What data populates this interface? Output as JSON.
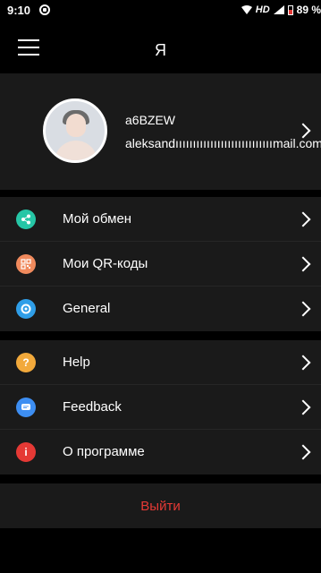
{
  "status_bar": {
    "time": "9:10",
    "network": "HD",
    "battery": "89 %"
  },
  "header": {
    "title": "Я"
  },
  "profile": {
    "username": "a6BZEW",
    "email": "aleksandıııııııııııııııııııııııııııımail.com"
  },
  "menu_group_1": [
    {
      "label": "Мой обмен",
      "icon": "share-icon",
      "color": "#26c6a6"
    },
    {
      "label": "Мои QR-коды",
      "icon": "qr-code-icon",
      "color": "#f08a5d"
    },
    {
      "label": "General",
      "icon": "settings-icon",
      "color": "#2f9ee8"
    }
  ],
  "menu_group_2": [
    {
      "label": "Help",
      "icon": "help-icon",
      "color": "#f2a93b"
    },
    {
      "label": "Feedback",
      "icon": "feedback-icon",
      "color": "#3d8ef2"
    },
    {
      "label": "О программе",
      "icon": "info-icon",
      "color": "#e53935"
    }
  ],
  "logout": {
    "label": "Выйти",
    "color": "#e53935"
  }
}
